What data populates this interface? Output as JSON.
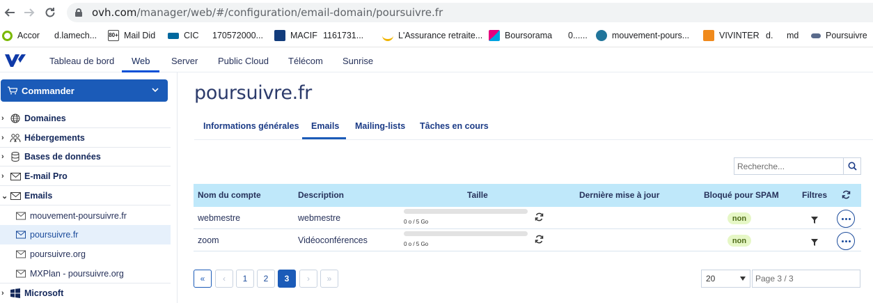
{
  "browser": {
    "url_host": "ovh.com",
    "url_path": "/manager/web/#/configuration/email-domain/poursuivre.fr",
    "bookmarks": [
      {
        "label": "Accor",
        "color": "#7ab800"
      },
      {
        "label": "d.lamech...",
        "color": ""
      },
      {
        "label": "Mail Did",
        "color": "#444"
      },
      {
        "label": "CIC",
        "color": "#00689e"
      },
      {
        "label": "170572000...",
        "color": ""
      },
      {
        "label": "MACIF",
        "color": "#123c7c"
      },
      {
        "label": "1161731...",
        "color": ""
      },
      {
        "label": "L'Assurance retraite...",
        "color": "#f0b400"
      },
      {
        "label": "Boursorama",
        "color": "#e6007e"
      },
      {
        "label": "0......",
        "color": ""
      },
      {
        "label": "mouvement-pours...",
        "color": "#21759b"
      },
      {
        "label": "VIVINTER",
        "color": "#f08a1c"
      },
      {
        "label": "d.",
        "color": ""
      },
      {
        "label": "md",
        "color": ""
      },
      {
        "label": "Poursuivre",
        "color": "#5a6b8c"
      }
    ]
  },
  "topnav": {
    "items": [
      "Tableau de bord",
      "Web",
      "Server",
      "Public Cloud",
      "Télécom",
      "Sunrise"
    ],
    "active": "Web"
  },
  "sidebar": {
    "order_button": "Commander",
    "items": [
      {
        "label": "Domaines",
        "icon": "globe-icon"
      },
      {
        "label": "Hébergements",
        "icon": "people-icon"
      },
      {
        "label": "Bases de données",
        "icon": "database-icon"
      },
      {
        "label": "E-mail Pro",
        "icon": "envelope-icon"
      },
      {
        "label": "Emails",
        "icon": "envelope-icon"
      }
    ],
    "sub_items": [
      {
        "label": "mouvement-poursuivre.fr",
        "active": false
      },
      {
        "label": "poursuivre.fr",
        "active": true
      },
      {
        "label": "poursuivre.org",
        "active": false
      },
      {
        "label": "MXPlan - poursuivre.org",
        "active": false
      }
    ],
    "last_item": {
      "label": "Microsoft",
      "icon": "windows-icon"
    }
  },
  "main": {
    "title": "poursuivre.fr",
    "tabs": [
      "Informations générales",
      "Emails",
      "Mailing-lists",
      "Tâches en cours"
    ],
    "active_tab": "Emails",
    "search_placeholder": "Recherche...",
    "table": {
      "headers": [
        "Nom du compte",
        "Description",
        "Taille",
        "Dernière mise à jour",
        "Bloqué pour SPAM",
        "Filtres"
      ],
      "rows": [
        {
          "account": "webmestre",
          "description": "webmestre",
          "size": "0 o / 5 Go",
          "usage": 0,
          "updated": "",
          "spam": "non"
        },
        {
          "account": "zoom",
          "description": "Vidéoconférences",
          "size": "0 o / 5 Go",
          "usage": 0,
          "updated": "",
          "spam": "non"
        }
      ]
    },
    "pagination": {
      "first": "«",
      "prev": "‹",
      "pages": [
        "1",
        "2",
        "3"
      ],
      "current": "3",
      "next": "›",
      "last": "»",
      "per_page": "20",
      "page_info": "Page 3 / 3"
    }
  }
}
